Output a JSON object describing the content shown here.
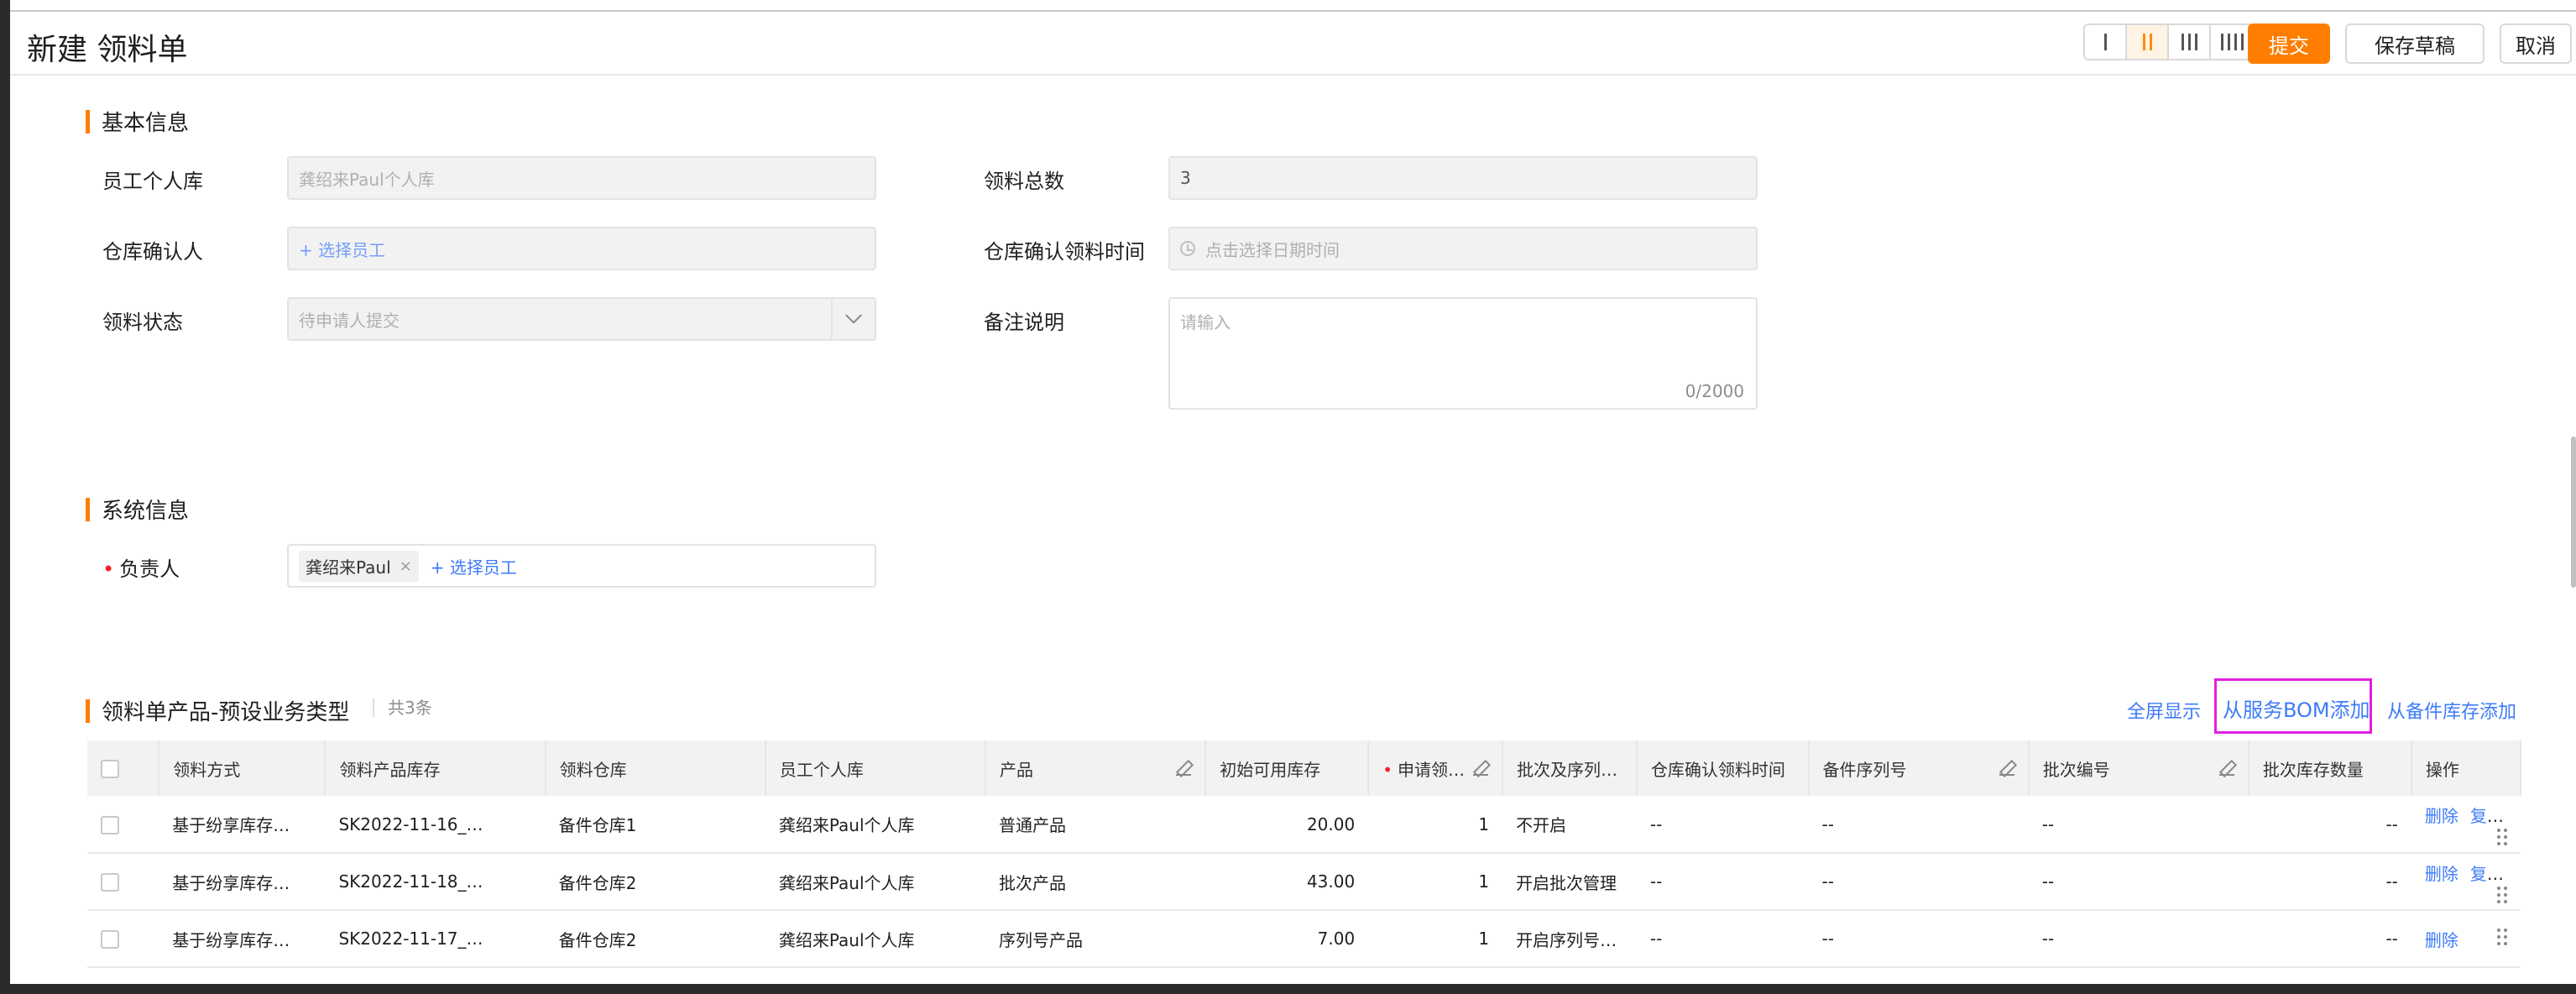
{
  "header": {
    "title": "新建 领料单",
    "submit_label": "提交",
    "save_draft_label": "保存草稿",
    "cancel_label": "取消",
    "layout_options": [
      "1-column",
      "2-column",
      "3-column",
      "4-column"
    ],
    "active_layout": "2-column"
  },
  "basic_info": {
    "section_title": "基本信息",
    "employee_library_label": "员工个人库",
    "employee_library_value": "龚绍来Paul个人库",
    "warehouse_confirmer_label": "仓库确认人",
    "warehouse_confirmer_placeholder": "+ 选择员工",
    "status_label": "领料状态",
    "status_value": "待申请人提交",
    "total_label": "领料总数",
    "total_value": "3",
    "confirm_time_label": "仓库确认领料时间",
    "confirm_time_placeholder": "点击选择日期时间",
    "remark_label": "备注说明",
    "remark_placeholder": "请输入",
    "remark_counter": "0/2000"
  },
  "system_info": {
    "section_title": "系统信息",
    "owner_label": "负责人",
    "owner_tag": "龚绍来Paul",
    "owner_tag_close": "×",
    "owner_add": "+ 选择员工"
  },
  "products": {
    "section_title": "领料单产品-预设业务类型",
    "count_text": "共3条",
    "fullscreen_label": "全屏显示",
    "add_from_bom_label": "从服务BOM添加",
    "add_from_stock_label": "从备件库存添加",
    "columns": [
      "领料方式",
      "领料产品库存",
      "领料仓库",
      "员工个人库",
      "产品",
      "初始可用库存",
      "申请领…",
      "批次及序列号…",
      "仓库确认领料时间",
      "备件序列号",
      "批次编号",
      "批次库存数量",
      "操作"
    ],
    "rows": [
      {
        "method": "基于纷享库存…",
        "stock": "SK2022-11-16_…",
        "warehouse": "备件仓库1",
        "library": "龚绍来Paul个人库",
        "product": "普通产品",
        "initial": "20.00",
        "apply": "1",
        "batch_mode": "不开启",
        "confirm_time": "--",
        "serial": "--",
        "batch_no": "--",
        "batch_qty": "--",
        "delete": "删除",
        "copy": "复制"
      },
      {
        "method": "基于纷享库存…",
        "stock": "SK2022-11-18_…",
        "warehouse": "备件仓库2",
        "library": "龚绍来Paul个人库",
        "product": "批次产品",
        "initial": "43.00",
        "apply": "1",
        "batch_mode": "开启批次管理",
        "confirm_time": "--",
        "serial": "--",
        "batch_no": "--",
        "batch_qty": "--",
        "delete": "删除",
        "copy": "复制"
      },
      {
        "method": "基于纷享库存…",
        "stock": "SK2022-11-17_…",
        "warehouse": "备件仓库2",
        "library": "龚绍来Paul个人库",
        "product": "序列号产品",
        "initial": "7.00",
        "apply": "1",
        "batch_mode": "开启序列号管理",
        "confirm_time": "--",
        "serial": "--",
        "batch_no": "--",
        "batch_qty": "--",
        "delete": "删除",
        "copy": ""
      }
    ]
  },
  "colors": {
    "accent": "#ff7d00",
    "link": "#3e7bfa",
    "highlight": "#e020e0",
    "required": "#f5222d"
  }
}
